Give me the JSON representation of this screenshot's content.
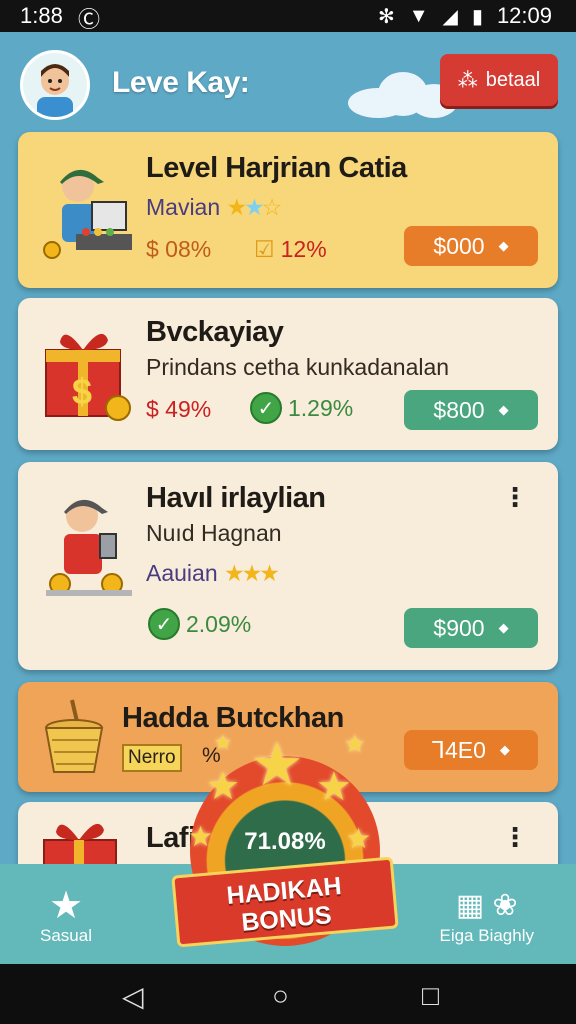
{
  "status_bar": {
    "time": "1:88",
    "clock": "12:09"
  },
  "header": {
    "title": "Leve Kay:",
    "detail_button": "betaal"
  },
  "cards": [
    {
      "title": "Level Harjrian Catia",
      "subtitle": "Mavian",
      "stat1": "$ 08%",
      "stat2": "12%",
      "price": "$000",
      "bg": "#f7d779",
      "price_bg": "#e77d29"
    },
    {
      "title": "Bvckayiay",
      "subtitle": "Prindans cetha kunkadanalan",
      "stat1": "$ 49%",
      "stat2": "1.29%",
      "price": "$800",
      "bg": "#f8ecdb",
      "price_bg": "#4aa67f"
    },
    {
      "title": "Havıl irlaylian",
      "subtitle": "Nuıd Hagnan",
      "tag": "Aauian",
      "stat2": "2.09%",
      "price": "$900",
      "bg": "#f8ecdb",
      "price_bg": "#4aa67f"
    },
    {
      "title": "Hadda Butckhan",
      "tag": "Nerro",
      "pct": "%",
      "price": "Ꞁ4E0",
      "bg": "#f0a457",
      "price_bg": "#e77d29"
    },
    {
      "title": "Lafi",
      "bg": "#f8ecdb"
    }
  ],
  "bonus": {
    "percent": "71.08%",
    "label_line1": "HADIKAH",
    "label_line2": "BONUS"
  },
  "bottom_nav": {
    "left_label": "Sasual",
    "right_label": "Eiga Biaghly"
  }
}
